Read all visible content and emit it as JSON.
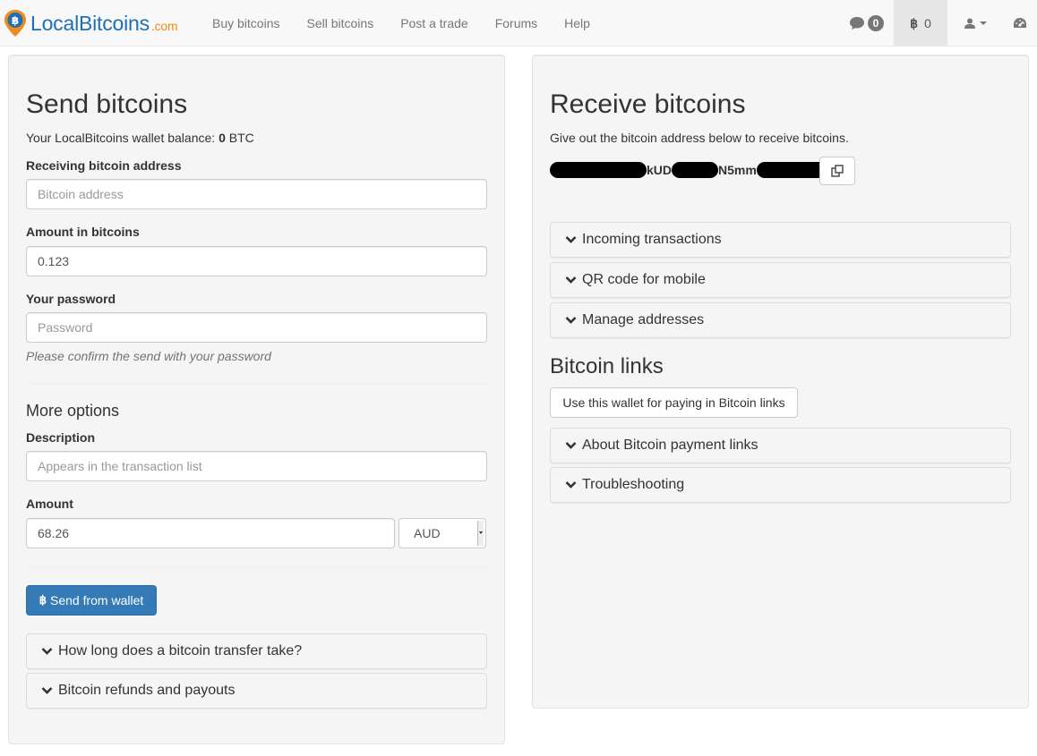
{
  "brand": {
    "name": "LocalBitcoins",
    "suffix": ".com"
  },
  "nav": {
    "links": [
      "Buy bitcoins",
      "Sell bitcoins",
      "Post a trade",
      "Forums",
      "Help"
    ],
    "chat_count": "0",
    "btc_symbol": "฿",
    "btc_balance": "0"
  },
  "send": {
    "title": "Send bitcoins",
    "balance_prefix": "Your LocalBitcoins wallet balance: ",
    "balance_value": "0",
    "balance_unit": " BTC",
    "address_label": "Receiving bitcoin address",
    "address_placeholder": "Bitcoin address",
    "amount_label": "Amount in bitcoins",
    "amount_value": "0.123",
    "password_label": "Your password",
    "password_placeholder": "Password",
    "password_help": "Please confirm the send with your password",
    "more_options": "More options",
    "description_label": "Description",
    "description_placeholder": "Appears in the transaction list",
    "fiat_label": "Amount",
    "fiat_value": "68.26",
    "currency": "AUD",
    "send_button": "Send from wallet",
    "send_symbol": "฿",
    "faq": [
      "How long does a bitcoin transfer take?",
      "Bitcoin refunds and payouts"
    ]
  },
  "receive": {
    "title": "Receive bitcoins",
    "subtitle": "Give out the bitcoin address below to receive bitcoins.",
    "address_fragments": [
      "kUD",
      "N5mm"
    ],
    "panels": [
      "Incoming transactions",
      "QR code for mobile",
      "Manage addresses"
    ],
    "links_title": "Bitcoin links",
    "links_button": "Use this wallet for paying in Bitcoin links",
    "link_panels": [
      "About Bitcoin payment links",
      "Troubleshooting"
    ]
  },
  "colors": {
    "primary": "#337ab7",
    "brand_blue": "#1f6fb5",
    "brand_orange": "#f08a1c"
  }
}
